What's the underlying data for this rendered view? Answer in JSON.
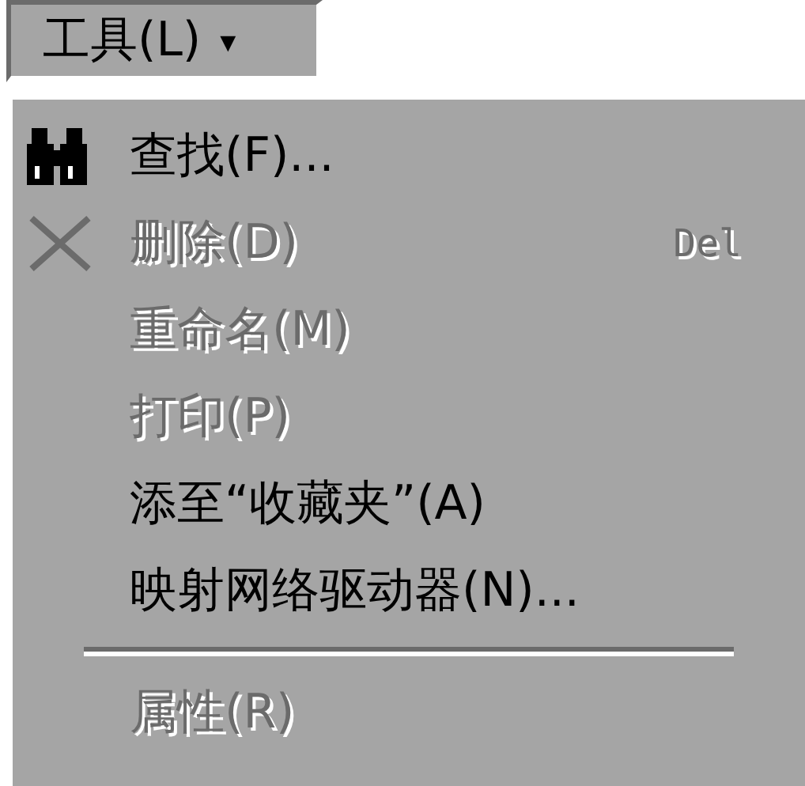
{
  "menu_button": {
    "label": "工具(L)",
    "arrow": "▾"
  },
  "items": [
    {
      "kind": "find",
      "label": "查找(F)...",
      "disabled": false
    },
    {
      "kind": "delete",
      "label": "删除(D)",
      "shortcut": "Del",
      "disabled": true
    },
    {
      "kind": "plain",
      "label": "重命名(M)",
      "disabled": true
    },
    {
      "kind": "plain",
      "label": "打印(P)",
      "disabled": true
    },
    {
      "kind": "plain",
      "label": "添至“收藏夹”(A)",
      "disabled": false
    },
    {
      "kind": "plain",
      "label": "映射网络驱动器(N)...",
      "disabled": false
    },
    {
      "kind": "separator"
    },
    {
      "kind": "plain",
      "label": "属性(R)",
      "disabled": true
    }
  ]
}
